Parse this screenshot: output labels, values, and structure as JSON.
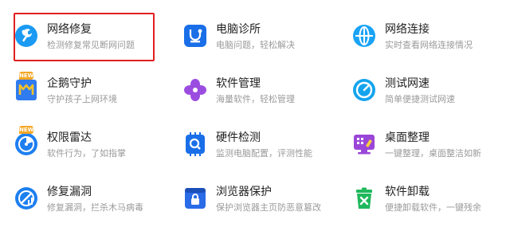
{
  "tools": [
    {
      "title": "网络修复",
      "desc": "检测修复常见断网问题",
      "icon": "wrench-icon",
      "color": "#1a9af2"
    },
    {
      "title": "电脑诊所",
      "desc": "电脑问题，轻松解决",
      "icon": "stethoscope-icon",
      "color": "#1a6fe8"
    },
    {
      "title": "网络连接",
      "desc": "实时查看网络连接情况",
      "icon": "globe-icon",
      "color": "#1aa3f5"
    },
    {
      "title": "企鹅守护",
      "desc": "守护孩子上网环境",
      "icon": "shield-m-icon",
      "color": "#2f7bf0",
      "badge": "NEW"
    },
    {
      "title": "软件管理",
      "desc": "海量软件，轻松管理",
      "icon": "petal-icon",
      "color": "#9b4de0"
    },
    {
      "title": "测试网速",
      "desc": "简单便捷测试网速",
      "icon": "speedometer-icon",
      "color": "#14a4ee"
    },
    {
      "title": "权限雷达",
      "desc": "软件行为，了如指掌",
      "icon": "radar-icon",
      "color": "#1d7ff0",
      "badge": "NEW"
    },
    {
      "title": "硬件检测",
      "desc": "监测电脑配置，评测性能",
      "icon": "chip-icon",
      "color": "#1a6fe8"
    },
    {
      "title": "桌面整理",
      "desc": "一键整理，桌面整洁如新",
      "icon": "desktop-icon",
      "color": "#9a46d8"
    },
    {
      "title": "修复漏洞",
      "desc": "修复漏洞，拦杀木马病毒",
      "icon": "bug-fix-icon",
      "color": "#1d7ff0"
    },
    {
      "title": "浏览器保护",
      "desc": "保护浏览器主页防恶意篡改",
      "icon": "browser-lock-icon",
      "color": "#2a6be8"
    },
    {
      "title": "软件卸载",
      "desc": "便捷卸载软件，一键残余",
      "icon": "trash-icon",
      "color": "#1fb85c"
    }
  ]
}
